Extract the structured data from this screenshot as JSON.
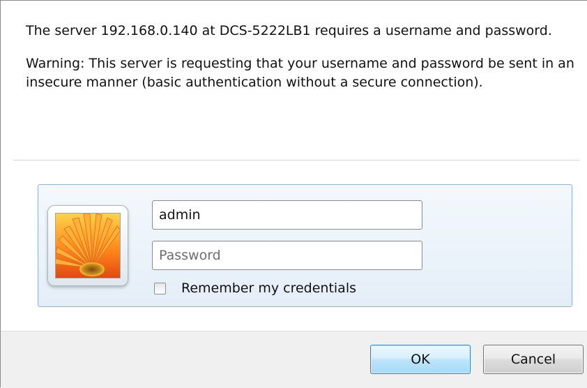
{
  "message": {
    "line1": "The server 192.168.0.140 at DCS-5222LB1 requires a username and password.",
    "warning": "Warning: This server is requesting that your username and password be sent in an insecure manner (basic authentication without a secure connection)."
  },
  "credentials": {
    "username_value": "admin",
    "password_placeholder": "Password",
    "remember_label": "Remember my credentials",
    "remember_checked": false,
    "avatar_icon": "flower-user-picture-icon"
  },
  "buttons": {
    "ok_label": "OK",
    "cancel_label": "Cancel"
  },
  "colors": {
    "panel_border": "#8fb3d6",
    "ok_border": "#3c7fb1"
  }
}
